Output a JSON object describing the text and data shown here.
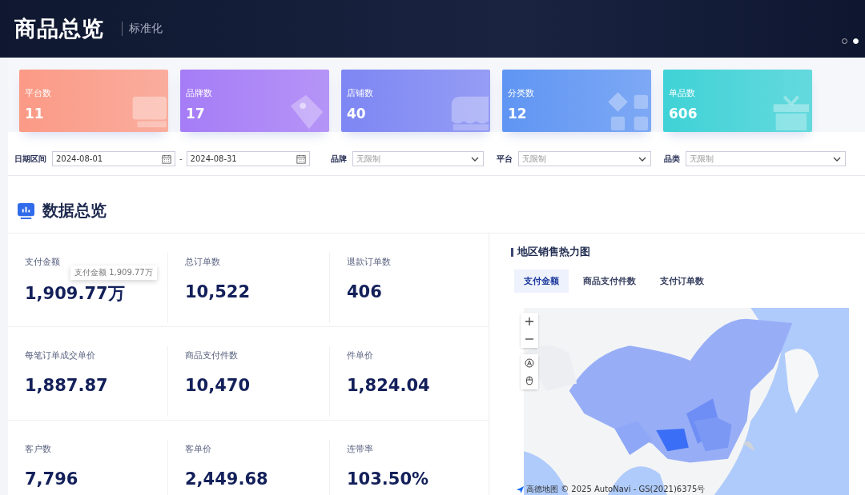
{
  "header": {
    "title": "商品总览",
    "subtitle": "标准化",
    "carousel": [
      {
        "selected": false
      },
      {
        "selected": true
      }
    ]
  },
  "stat_cards": [
    {
      "label": "平台数",
      "value": "11",
      "kind": "monitor",
      "color": "#fb9a86"
    },
    {
      "label": "品牌数",
      "value": "17",
      "kind": "tag",
      "color": "#a57cf6"
    },
    {
      "label": "店铺数",
      "value": "40",
      "kind": "store",
      "color": "#7d86f3"
    },
    {
      "label": "分类数",
      "value": "12",
      "kind": "grid",
      "color": "#5f95f3"
    },
    {
      "label": "单品数",
      "value": "606",
      "kind": "gift",
      "color": "#3fd2d6"
    }
  ],
  "filters": {
    "date_label": "日期区间",
    "date_start": "2024-08-01",
    "date_sep": "-",
    "date_end": "2024-08-31",
    "selects": [
      {
        "label": "品牌",
        "placeholder": "无限制"
      },
      {
        "label": "平台",
        "placeholder": "无限制"
      },
      {
        "label": "品类",
        "placeholder": "无限制"
      }
    ]
  },
  "overview": {
    "title": "数据总览",
    "metrics": [
      {
        "label": "支付金额",
        "value": "1,909.77万",
        "tooltip": "支付金额 1,909.77万"
      },
      {
        "label": "总订单数",
        "value": "10,522"
      },
      {
        "label": "退款订单数",
        "value": "406"
      },
      {
        "label": "每笔订单成交单价",
        "value": "1,887.87"
      },
      {
        "label": "商品支付件数",
        "value": "10,470"
      },
      {
        "label": "件单价",
        "value": "1,824.04"
      },
      {
        "label": "客户数",
        "value": "7,796"
      },
      {
        "label": "客单价",
        "value": "2,449.68"
      },
      {
        "label": "连带率",
        "value": "103.50%"
      }
    ]
  },
  "heatmap": {
    "title": "地区销售热力图",
    "tabs": [
      {
        "label": "支付金额",
        "selected": true
      },
      {
        "label": "商品支付件数",
        "selected": false
      },
      {
        "label": "支付订单数",
        "selected": false
      }
    ],
    "map": {
      "kind": "picture",
      "attribution": "高德地图 © 2025 AutoNavi - GS(2021)6375号"
    }
  }
}
